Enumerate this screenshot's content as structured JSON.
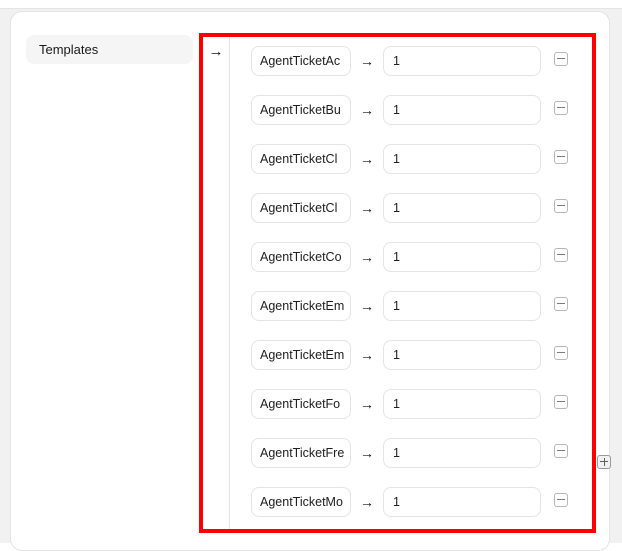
{
  "page": {
    "section_label": "Templates",
    "arrow_glyph": "→",
    "hash_arrow_glyph": "→",
    "highlight_color": "#fc0000",
    "pill_background": "#f5f5f5",
    "field_border_color": "#e4e4e4"
  },
  "mapping": {
    "add_button_label": "+",
    "remove_button_label": "−",
    "rows": [
      {
        "key": "AgentTicketAc",
        "value": "1",
        "remove_icon": "minus-icon"
      },
      {
        "key": "AgentTicketBu",
        "value": "1",
        "remove_icon": "minus-icon"
      },
      {
        "key": "AgentTicketCl",
        "value": "1",
        "remove_icon": "minus-icon"
      },
      {
        "key": "AgentTicketCl",
        "value": "1",
        "remove_icon": "minus-icon"
      },
      {
        "key": "AgentTicketCo",
        "value": "1",
        "remove_icon": "minus-icon"
      },
      {
        "key": "AgentTicketEm",
        "value": "1",
        "remove_icon": "minus-icon"
      },
      {
        "key": "AgentTicketEm",
        "value": "1",
        "remove_icon": "minus-icon"
      },
      {
        "key": "AgentTicketFo",
        "value": "1",
        "remove_icon": "minus-icon"
      },
      {
        "key": "AgentTicketFre",
        "value": "1",
        "remove_icon": "minus-icon"
      },
      {
        "key": "AgentTicketMo",
        "value": "1",
        "remove_icon": "minus-icon"
      }
    ]
  }
}
